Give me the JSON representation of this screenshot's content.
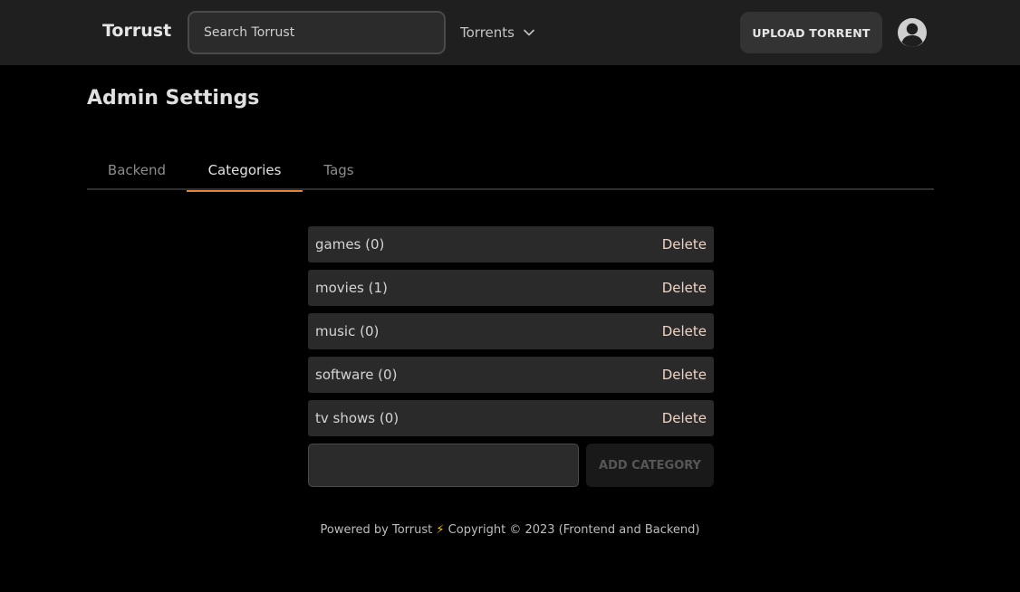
{
  "header": {
    "brand": "Torrust",
    "search_placeholder": "Search Torrust",
    "nav_torrents_label": "Torrents",
    "upload_label": "UPLOAD TORRENT"
  },
  "page": {
    "title": "Admin Settings"
  },
  "tabs": [
    {
      "label": "Backend",
      "active": false
    },
    {
      "label": "Categories",
      "active": true
    },
    {
      "label": "Tags",
      "active": false
    }
  ],
  "categories": [
    {
      "label": "games (0)",
      "action": "Delete"
    },
    {
      "label": "movies (1)",
      "action": "Delete"
    },
    {
      "label": "music (0)",
      "action": "Delete"
    },
    {
      "label": "software (0)",
      "action": "Delete"
    },
    {
      "label": "tv shows (0)",
      "action": "Delete"
    }
  ],
  "add_category": {
    "input_value": "",
    "button_label": "ADD CATEGORY"
  },
  "footer": {
    "powered_prefix": "Powered by Torrust",
    "bolt": "⚡",
    "copyright": "Copyright © 2023 (Frontend and Backend)"
  },
  "colors": {
    "accent": "#d9844a",
    "background": "#000000",
    "navbar": "#1f1f1f",
    "row": "#2a2a2a",
    "delete_text": "#eed3c6"
  },
  "icons": {
    "nav_dropdown": "chevron-down-icon",
    "avatar": "user-circle-icon",
    "footer": "lightning-bolt-icon"
  }
}
